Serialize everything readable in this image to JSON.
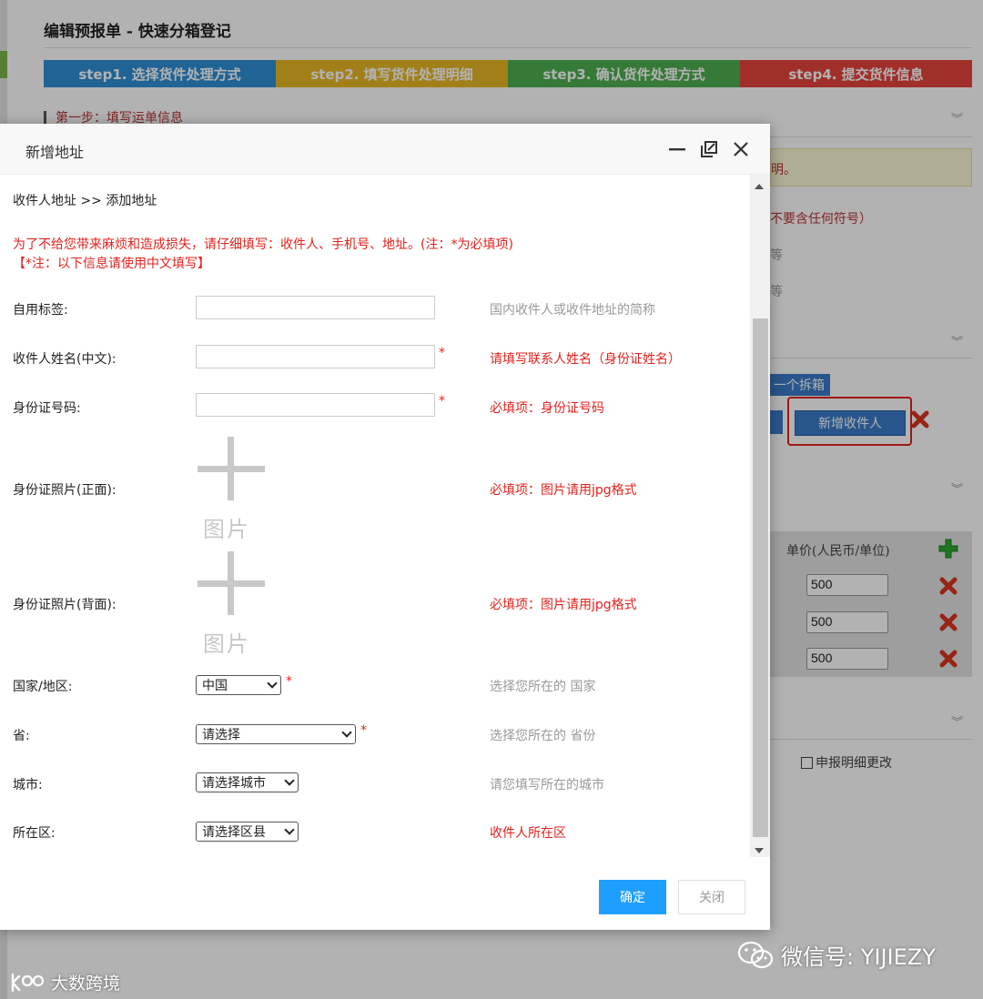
{
  "background": {
    "page_title": "编辑预报单   -   快速分箱登记",
    "steps": [
      {
        "label": "step1. 选择货件处理方式",
        "color": "#2e8fd6"
      },
      {
        "label": "step2. 填写货件处理明细",
        "color": "#e9b824"
      },
      {
        "label": "step3. 确认货件处理方式",
        "color": "#4caf50"
      },
      {
        "label": "step4. 提交货件信息",
        "color": "#e5443d"
      }
    ],
    "section1_title": "第一步：填写运单信息",
    "note_fragment": "明。",
    "symbol_hint_fragment": "不要含任何符号）",
    "etc_fragment_1": "等",
    "etc_fragment_2": "等",
    "split_box_label": "一个拆箱",
    "add_recipient_button": "新增收件人",
    "unit_price_header": "单价(人民币/单位)",
    "price_values": [
      "500",
      "500",
      "500"
    ],
    "declare_change_label": "申报明细更改"
  },
  "modal": {
    "title": "新增地址",
    "breadcrumb": "收件人地址  >> 添加地址",
    "warning_line1": "为了不给您带来麻烦和造成损失，请仔细填写：收件人、手机号、地址。(注：*为必填项)",
    "warning_line2": "【*注：以下信息请使用中文填写】",
    "required_mark": "*",
    "fields": {
      "tag": {
        "label": "自用标签:",
        "value": "",
        "hint": "国内收件人或收件地址的简称"
      },
      "name": {
        "label": "收件人姓名(中文):",
        "value": "",
        "hint": "请填写联系人姓名（身份证姓名）"
      },
      "id_number": {
        "label": "身份证号码:",
        "value": "",
        "hint": "必填项：身份证号码"
      },
      "id_front": {
        "label": "身份证照片(正面):",
        "upload_text": "图片",
        "hint": "必填项：图片请用jpg格式"
      },
      "id_back": {
        "label": "身份证照片(背面):",
        "upload_text": "图片",
        "hint": "必填项：图片请用jpg格式"
      },
      "country": {
        "label": "国家/地区:",
        "selected": "中国",
        "hint": "选择您所在的 国家"
      },
      "province": {
        "label": "省:",
        "selected": "请选择",
        "hint": "选择您所在的 省份"
      },
      "city": {
        "label": "城市:",
        "selected": "请选择城市",
        "hint": "请您填写所在的城市"
      },
      "district": {
        "label": "所在区:",
        "selected": "请选择区县",
        "hint": "收件人所在区"
      }
    },
    "confirm_button": "确定",
    "close_button": "关闭"
  },
  "watermarks": {
    "right": "微信号: YIJIEZY",
    "left": "大数跨境"
  },
  "colors": {
    "primary_button": "#1e9fff",
    "required_red": "#e3211c",
    "highlight_border": "#e3211c",
    "background_blue_button": "#3a7cc9"
  }
}
